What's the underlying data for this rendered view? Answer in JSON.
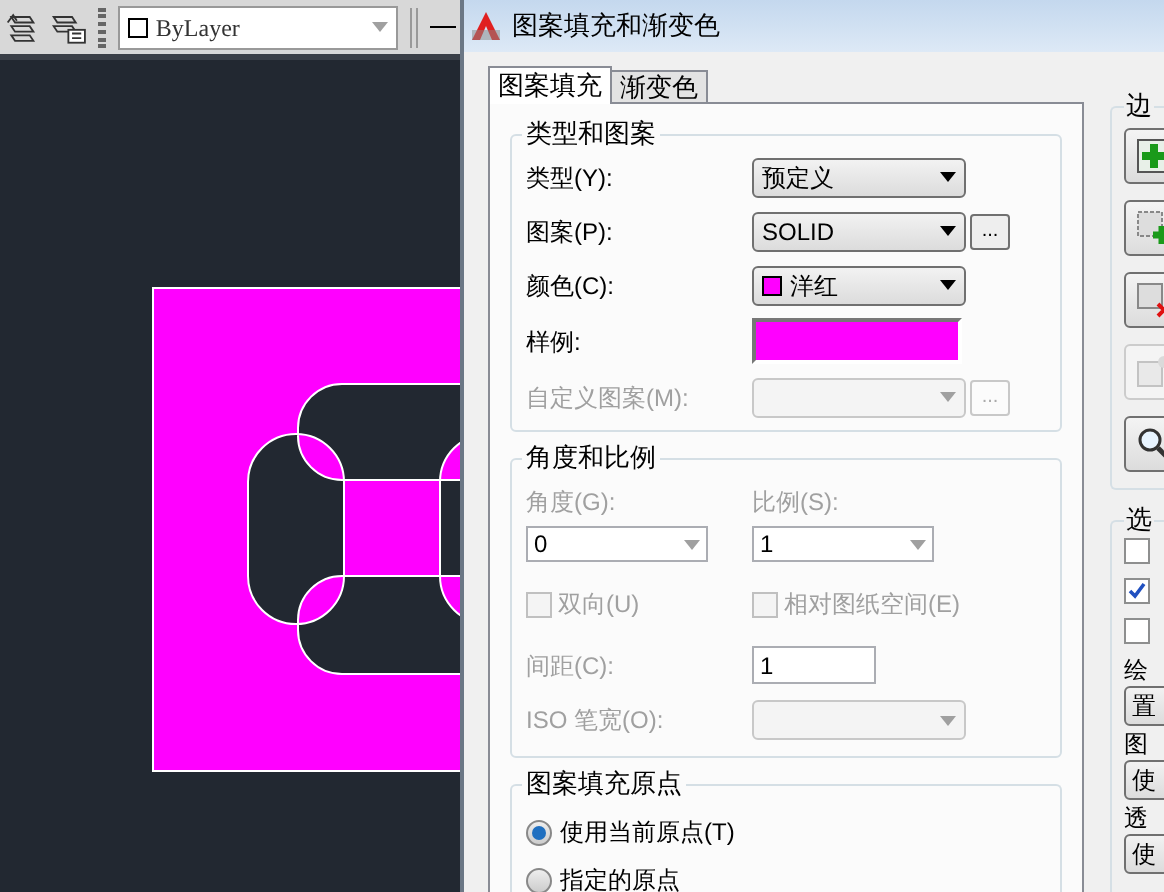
{
  "toolbar": {
    "layer_combo": {
      "value": "ByLayer"
    }
  },
  "dialog": {
    "title": "图案填充和渐变色",
    "tabs": [
      {
        "label": "图案填充",
        "selected": true
      },
      {
        "label": "渐变色",
        "selected": false
      }
    ],
    "type_group": {
      "title": "类型和图案",
      "rows": [
        {
          "kind": "combo",
          "label": "类型(Y):",
          "value": "预定义",
          "disabled": false
        },
        {
          "kind": "combo",
          "label": "图案(P):",
          "value": "SOLID",
          "browse": "...",
          "disabled": false
        },
        {
          "kind": "color",
          "label": "颜色(C):",
          "value": "洋红",
          "color": "#ff00ff"
        },
        {
          "kind": "swatch",
          "label": "样例:",
          "color": "#ff00ff"
        },
        {
          "kind": "combo",
          "label": "自定义图案(M):",
          "browse": "...",
          "disabled": true
        }
      ]
    },
    "angle_group": {
      "title": "角度和比例",
      "disabled": true,
      "angle": {
        "label": "角度(G):",
        "value": "0"
      },
      "scale": {
        "label": "比例(S):",
        "value": "1"
      },
      "double": {
        "label": "双向(U)",
        "checked": false
      },
      "relative": {
        "label": "相对图纸空间(E)",
        "checked": false
      },
      "spacing": {
        "label": "间距(C):",
        "value": "1"
      },
      "iso": {
        "label": "ISO 笔宽(O):"
      }
    },
    "origin_group": {
      "title": "图案填充原点",
      "options": [
        {
          "label": "使用当前原点(T)",
          "selected": true
        },
        {
          "label": "指定的原点",
          "selected": false
        }
      ]
    },
    "boundary_group": {
      "title": "边",
      "buttons": [
        {
          "kind": "add-point",
          "disabled": false
        },
        {
          "kind": "add-object",
          "disabled": false
        },
        {
          "kind": "remove",
          "disabled": false
        },
        {
          "kind": "recreate",
          "disabled": true
        },
        {
          "kind": "view",
          "disabled": false
        }
      ]
    },
    "options_group": {
      "title": "选",
      "checkboxes": [
        {
          "checked": false
        },
        {
          "checked": true
        },
        {
          "checked": false
        }
      ],
      "fields": [
        {
          "label": "绘",
          "value": "置"
        },
        {
          "label": "图",
          "value": "使"
        },
        {
          "label": "透",
          "value": "使"
        }
      ]
    }
  }
}
